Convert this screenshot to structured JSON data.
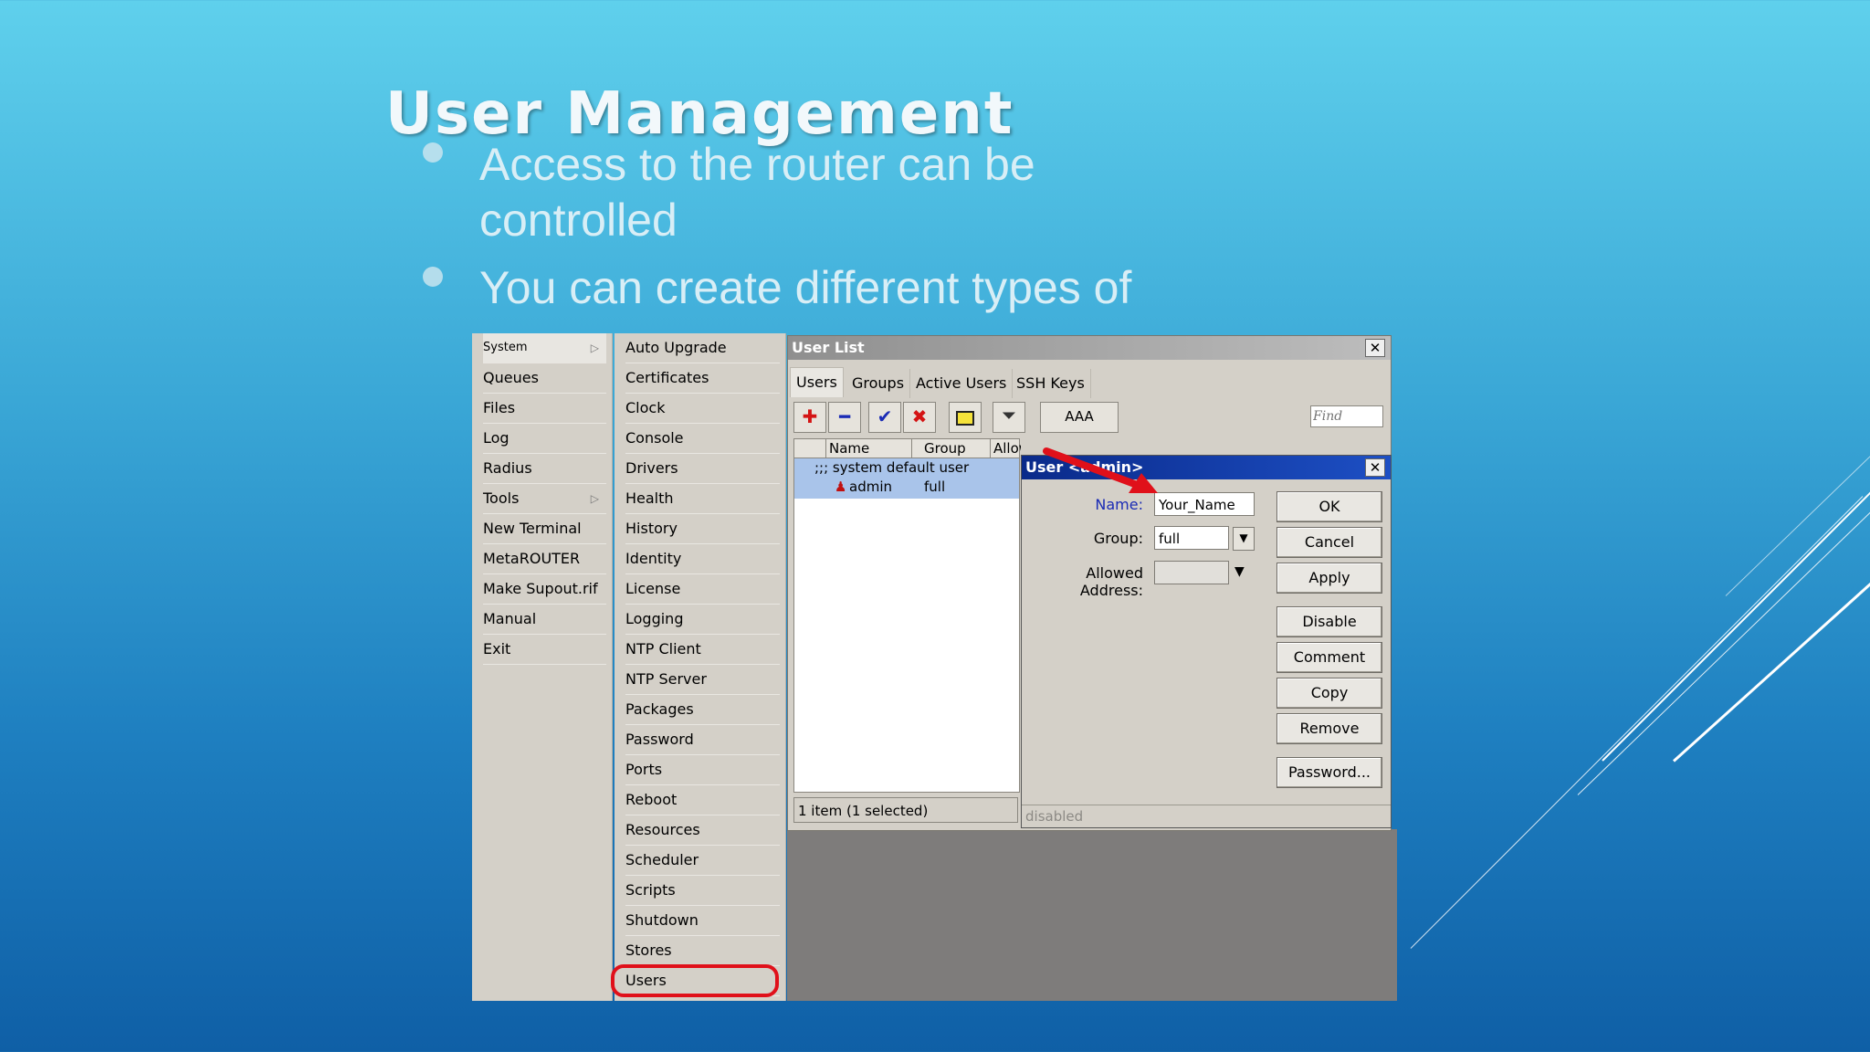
{
  "slide": {
    "title": "User Management",
    "bullets": [
      "Access to the router can be controlled",
      "You can create different types of users"
    ]
  },
  "left_menu": {
    "items": [
      {
        "label": "System",
        "submenu": true
      },
      {
        "label": "Queues"
      },
      {
        "label": "Files"
      },
      {
        "label": "Log"
      },
      {
        "label": "Radius"
      },
      {
        "label": "Tools",
        "submenu": true
      },
      {
        "label": "New Terminal"
      },
      {
        "label": "MetaROUTER"
      },
      {
        "label": "Make Supout.rif"
      },
      {
        "label": "Manual"
      },
      {
        "label": "Exit"
      }
    ]
  },
  "system_submenu": {
    "items": [
      "Auto Upgrade",
      "Certificates",
      "Clock",
      "Console",
      "Drivers",
      "Health",
      "History",
      "Identity",
      "License",
      "Logging",
      "NTP Client",
      "NTP Server",
      "Packages",
      "Password",
      "Ports",
      "Reboot",
      "Resources",
      "Scheduler",
      "Scripts",
      "Shutdown",
      "Stores",
      "Users"
    ],
    "highlighted": "Users"
  },
  "user_list": {
    "title": "User List",
    "tabs": [
      "Users",
      "Groups",
      "Active Users",
      "SSH Keys"
    ],
    "aaa_label": "AAA",
    "find_placeholder": "Find",
    "columns": [
      "Name",
      "Group",
      "Allowed Addr..."
    ],
    "comment_row": ";;; system default user",
    "row": {
      "name": "admin",
      "group": "full"
    },
    "status": "1 item (1 selected)"
  },
  "user_dialog": {
    "title": "User <admin>",
    "name_label": "Name:",
    "name_value": "Your_Name",
    "group_label": "Group:",
    "group_value": "full",
    "allowed_label": "Allowed Address:",
    "buttons": [
      "OK",
      "Cancel",
      "Apply",
      "Disable",
      "Comment",
      "Copy",
      "Remove",
      "Password..."
    ],
    "status": "disabled"
  },
  "colors": {
    "accent_red": "#e0101a",
    "title_bar": "#0a2a8a",
    "selection": "#a9c4ea"
  },
  "icons": [
    "add-icon",
    "remove-icon",
    "enable-icon",
    "disable-icon",
    "comment-icon",
    "filter-icon",
    "user-icon",
    "arrow-annotation-icon"
  ]
}
